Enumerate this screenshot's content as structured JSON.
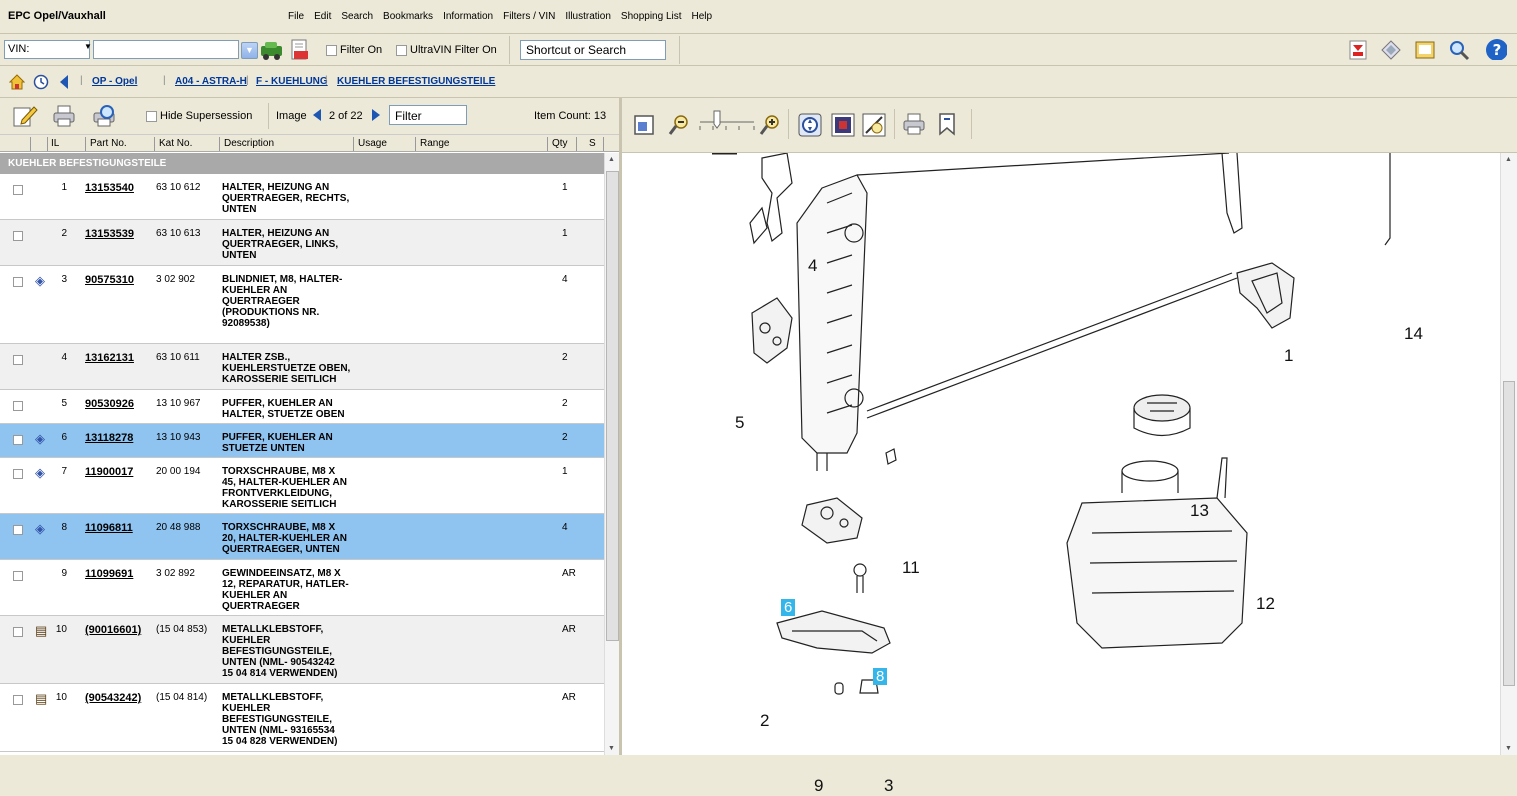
{
  "app": {
    "brand": "EPC  Opel/Vauxhall"
  },
  "menu": [
    "File",
    "Edit",
    "Search",
    "Bookmarks",
    "Information",
    "Filters / VIN",
    "Illustration",
    "Shopping List",
    "Help"
  ],
  "toolbar": {
    "vin_label": "VIN:",
    "filter_on": "Filter On",
    "ultravin": "UltraVIN Filter On",
    "shortcut": "Shortcut or Search"
  },
  "breadcrumb": [
    "OP - Opel",
    "A04 - ASTRA-H",
    "F - KUEHLUNG",
    "KUEHLER BEFESTIGUNGSTEILE"
  ],
  "parts_toolbar": {
    "hide_supersession": "Hide Supersession",
    "image_label": "Image",
    "image_pos": "2 of 22",
    "filter_placeholder": "Filter",
    "item_count": "Item Count: 13"
  },
  "columns": {
    "il": "IL",
    "part_no": "Part No.",
    "kat_no": "Kat No.",
    "description": "Description",
    "usage": "Usage",
    "range": "Range",
    "qty": "Qty",
    "s": "S"
  },
  "group_header": "KUEHLER BEFESTIGUNGSTEILE",
  "rows": [
    {
      "il": "1",
      "part_no": "13153540",
      "kat_no": "63 10 612",
      "desc": [
        "HALTER, HEIZUNG AN",
        "QUERTRAEGER, RECHTS,",
        "UNTEN"
      ],
      "qty": "1",
      "icon": ""
    },
    {
      "il": "2",
      "part_no": "13153539",
      "kat_no": "63 10 613",
      "desc": [
        "HALTER, HEIZUNG AN",
        "QUERTRAEGER, LINKS,",
        "UNTEN"
      ],
      "qty": "1",
      "icon": ""
    },
    {
      "il": "3",
      "part_no": "90575310",
      "kat_no": "3 02 902",
      "desc": [
        "BLINDNIET, M8, HALTER-",
        "KUEHLER AN",
        "QUERTRAEGER",
        "(PRODUKTIONS NR.",
        "92089538)"
      ],
      "qty": "4",
      "icon": "info"
    },
    {
      "il": "4",
      "part_no": "13162131",
      "kat_no": "63 10 611",
      "desc": [
        "HALTER ZSB.,",
        "KUEHLERSTUETZE OBEN,",
        "KAROSSERIE SEITLICH"
      ],
      "qty": "2",
      "icon": ""
    },
    {
      "il": "5",
      "part_no": "90530926",
      "kat_no": "13 10 967",
      "desc": [
        "PUFFER, KUEHLER AN",
        "HALTER, STUETZE OBEN"
      ],
      "qty": "2",
      "icon": ""
    },
    {
      "il": "6",
      "part_no": "13118278",
      "kat_no": "13 10 943",
      "desc": [
        "PUFFER, KUEHLER AN",
        "STUETZE UNTEN"
      ],
      "qty": "2",
      "icon": "info"
    },
    {
      "il": "7",
      "part_no": "11900017",
      "kat_no": "20 00 194",
      "desc": [
        "TORXSCHRAUBE, M8 X",
        "45, HALTER-KUEHLER AN",
        "FRONTVERKLEIDUNG,",
        "KAROSSERIE SEITLICH"
      ],
      "qty": "1",
      "icon": "info"
    },
    {
      "il": "8",
      "part_no": "11096811",
      "kat_no": "20 48 988",
      "desc": [
        "TORXSCHRAUBE, M8 X",
        "20, HALTER-KUEHLER AN",
        "QUERTRAEGER, UNTEN"
      ],
      "qty": "4",
      "icon": "info"
    },
    {
      "il": "9",
      "part_no": "11099691",
      "kat_no": "3 02 892",
      "desc": [
        "GEWINDEEINSATZ, M8 X",
        "12, REPARATUR, HATLER-",
        "KUEHLER AN",
        "QUERTRAEGER"
      ],
      "qty": "AR",
      "icon": ""
    },
    {
      "il": "10",
      "part_no": "(90016601)",
      "kat_no": "(15 04 853)",
      "desc": [
        "METALLKLEBSTOFF,",
        "KUEHLER",
        "BEFESTIGUNGSTEILE,",
        "UNTEN  (NML- 90543242",
        "15 04 814 VERWENDEN)"
      ],
      "qty": "AR",
      "icon": "book"
    },
    {
      "il": "10",
      "part_no": "(90543242)",
      "kat_no": "(15 04 814)",
      "desc": [
        "METALLKLEBSTOFF,",
        "KUEHLER",
        "BEFESTIGUNGSTEILE,",
        "UNTEN  (NML- 93165534",
        "15 04 828 VERWENDEN)"
      ],
      "qty": "AR",
      "icon": "book"
    }
  ],
  "illustration": {
    "callouts": [
      "4",
      "14",
      "1",
      "5",
      "13",
      "11",
      "6",
      "12",
      "8",
      "2",
      "9",
      "3"
    ]
  }
}
